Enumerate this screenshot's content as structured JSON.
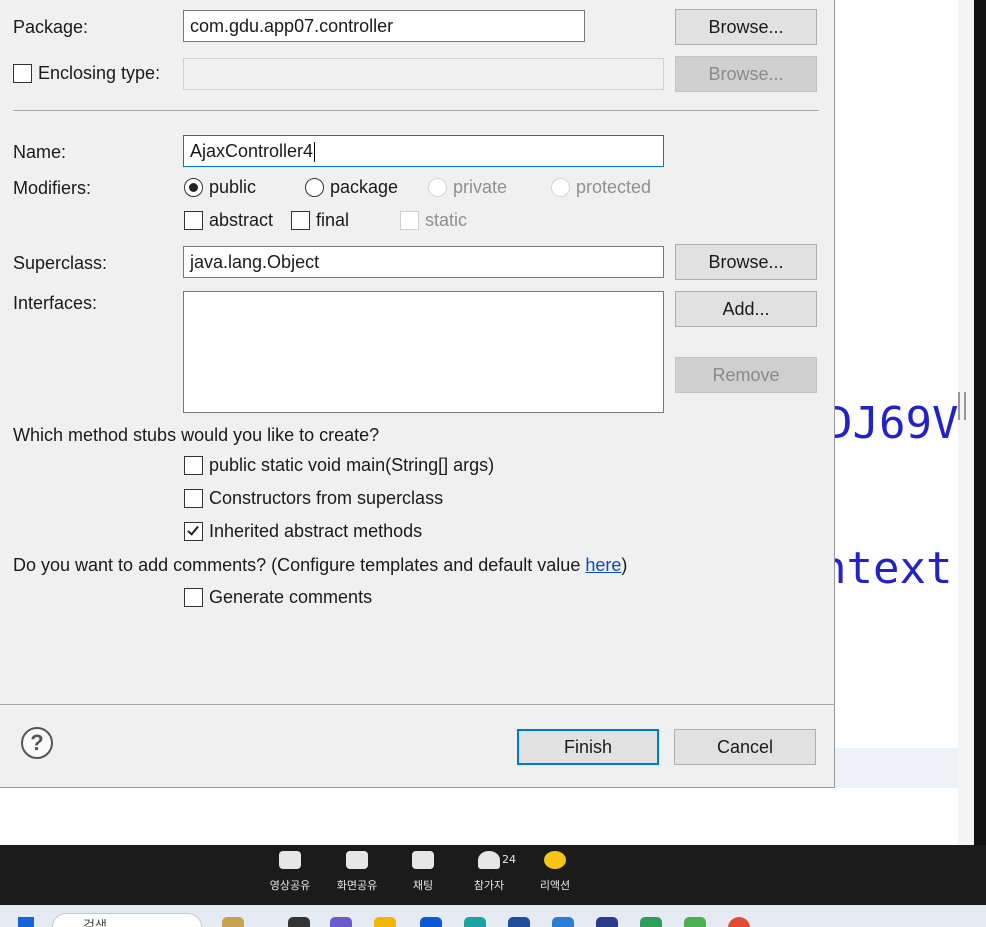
{
  "dialog": {
    "package_label": "Package:",
    "package_value": "com.gdu.app07.controller",
    "package_browse": "Browse...",
    "enclosing_label": "Enclosing type:",
    "enclosing_value": "",
    "enclosing_checked": false,
    "enclosing_browse": "Browse...",
    "name_label": "Name:",
    "name_value": "AjaxController4",
    "modifiers_label": "Modifiers:",
    "modifiers": {
      "public": "public",
      "package": "package",
      "private": "private",
      "protected": "protected",
      "selected": "public",
      "abstract": "abstract",
      "final": "final",
      "static": "static"
    },
    "superclass_label": "Superclass:",
    "superclass_value": "java.lang.Object",
    "superclass_browse": "Browse...",
    "interfaces_label": "Interfaces:",
    "interfaces_add": "Add...",
    "interfaces_remove": "Remove",
    "stubs_question": "Which method stubs would you like to create?",
    "stubs": [
      {
        "label": "public static void main(String[] args)",
        "checked": false
      },
      {
        "label": "Constructors from superclass",
        "checked": false
      },
      {
        "label": "Inherited abstract methods",
        "checked": true
      }
    ],
    "comments_question_prefix": "Do you want to add comments? (Configure templates and default value ",
    "comments_link": "here",
    "comments_question_suffix": ")",
    "generate_comments": "Generate comments",
    "generate_checked": false,
    "help": "?",
    "finish": "Finish",
    "cancel": "Cancel"
  },
  "background_editor": {
    "code_line_1": "DJ69V",
    "code_line_2": "ntext"
  },
  "meeting_toolbar": {
    "items": [
      {
        "label": "영상공유",
        "icon": "video-share-icon"
      },
      {
        "label": "화면공유",
        "icon": "screen-share-icon"
      },
      {
        "label": "채팅",
        "icon": "chat-icon"
      },
      {
        "label": "참가자",
        "icon": "participants-icon"
      },
      {
        "label": "리액션",
        "icon": "reaction-icon"
      }
    ],
    "participant_count": "24"
  },
  "taskbar": {
    "search_placeholder": "검색"
  },
  "colors": {
    "dialog_bg": "#f0f0f0",
    "focus_blue": "#0078d7",
    "link_blue": "#0a4bc4",
    "editor_code": "#2222c8",
    "meeting_bar": "#1b1b1b"
  }
}
